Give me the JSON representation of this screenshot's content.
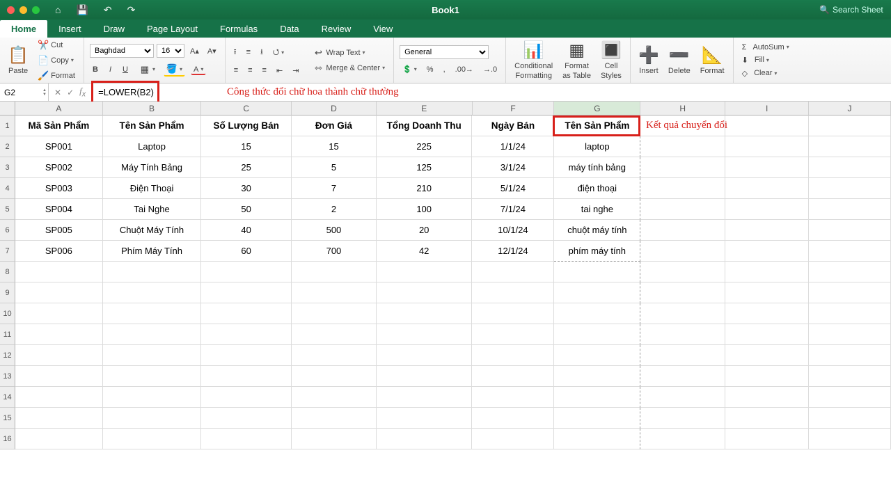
{
  "title": "Book1",
  "search_placeholder": "Search Sheet",
  "tabs": [
    "Home",
    "Insert",
    "Draw",
    "Page Layout",
    "Formulas",
    "Data",
    "Review",
    "View"
  ],
  "active_tab": "Home",
  "ribbon": {
    "paste": "Paste",
    "cut": "Cut",
    "copy": "Copy",
    "format_painter": "Format",
    "font_name": "Baghdad",
    "font_size": "16",
    "wrap": "Wrap Text",
    "merge": "Merge & Center",
    "number_format": "General",
    "cond": "Conditional",
    "cond2": "Formatting",
    "fmt_table": "Format",
    "fmt_table2": "as Table",
    "cell_styles": "Cell",
    "cell_styles2": "Styles",
    "insert": "Insert",
    "delete": "Delete",
    "format": "Format",
    "autosum": "AutoSum",
    "fill": "Fill",
    "clear": "Clear"
  },
  "namebox": "G2",
  "formula": "=LOWER(B2)",
  "annotation_formula": "Công thức đổi chữ hoa thành chữ thường",
  "annotation_result": "Kết quả chuyển đổi",
  "columns": [
    "A",
    "B",
    "C",
    "D",
    "E",
    "F",
    "G",
    "H",
    "I",
    "J"
  ],
  "headers": [
    "Mã Sản Phẩm",
    "Tên Sản Phẩm",
    "Số Lượng Bán",
    "Đơn Giá",
    "Tổng Doanh Thu",
    "Ngày Bán",
    "Tên Sản Phẩm"
  ],
  "rows": [
    {
      "a": "SP001",
      "b": "Laptop",
      "c": "15",
      "d": "15",
      "e": "225",
      "f": "1/1/24",
      "g": "laptop"
    },
    {
      "a": "SP002",
      "b": "Máy Tính Bảng",
      "c": "25",
      "d": "5",
      "e": "125",
      "f": "3/1/24",
      "g": "máy tính bảng"
    },
    {
      "a": "SP003",
      "b": "Điện Thoại",
      "c": "30",
      "d": "7",
      "e": "210",
      "f": "5/1/24",
      "g": "điện thoại"
    },
    {
      "a": "SP004",
      "b": "Tai Nghe",
      "c": "50",
      "d": "2",
      "e": "100",
      "f": "7/1/24",
      "g": "tai nghe"
    },
    {
      "a": "SP005",
      "b": "Chuột Máy Tính",
      "c": "40",
      "d": "500",
      "e": "20",
      "f": "10/1/24",
      "g": "chuột máy tính"
    },
    {
      "a": "SP006",
      "b": "Phím Máy Tính",
      "c": "60",
      "d": "700",
      "e": "42",
      "f": "12/1/24",
      "g": "phím máy tính"
    }
  ],
  "row_numbers": [
    "1",
    "2",
    "3",
    "4",
    "5",
    "6",
    "7",
    "8",
    "9",
    "10",
    "11",
    "12",
    "13",
    "14",
    "15",
    "16"
  ]
}
